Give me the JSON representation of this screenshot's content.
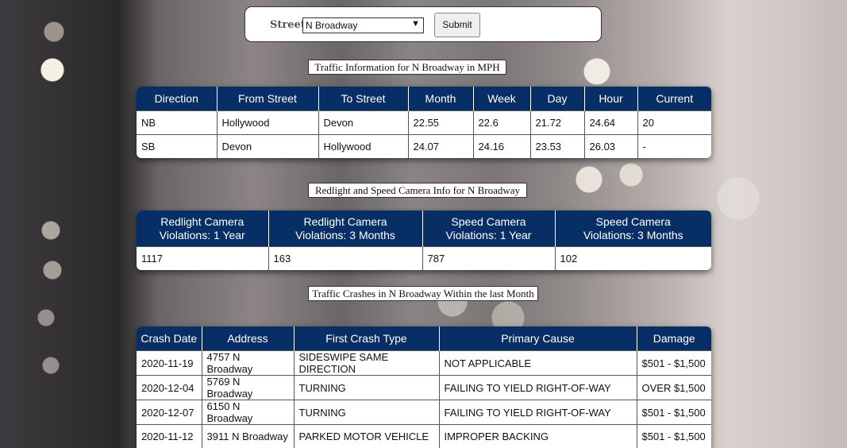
{
  "form": {
    "street_label": "Street:",
    "street_value": "N Broadway",
    "submit_label": "Submit"
  },
  "traffic": {
    "caption": "Traffic Information for N Broadway in MPH",
    "headers": [
      "Direction",
      "From Street",
      "To Street",
      "Month",
      "Week",
      "Day",
      "Hour",
      "Current"
    ],
    "rows": [
      [
        "NB",
        "Hollywood",
        "Devon",
        "22.55",
        "22.6",
        "21.72",
        "24.64",
        "20"
      ],
      [
        "SB",
        "Devon",
        "Hollywood",
        "24.07",
        "24.16",
        "23.53",
        "26.03",
        "-"
      ]
    ]
  },
  "cameras": {
    "caption": "Redlight and Speed Camera Info for N Broadway",
    "headers": [
      [
        "Redlight Camera",
        "Violations: 1 Year"
      ],
      [
        "Redlight Camera",
        "Violations: 3 Months"
      ],
      [
        "Speed Camera",
        "Violations: 1 Year"
      ],
      [
        "Speed Camera",
        "Violations: 3 Months"
      ]
    ],
    "rows": [
      [
        "1117",
        "163",
        "787",
        "102"
      ]
    ]
  },
  "crashes": {
    "caption": "Traffic Crashes in N Broadway Within the last Month",
    "headers": [
      "Crash Date",
      "Address",
      "First Crash Type",
      "Primary Cause",
      "Damage"
    ],
    "rows": [
      [
        "2020-11-19",
        "4757 N Broadway",
        "SIDESWIPE SAME DIRECTION",
        "NOT APPLICABLE",
        "$501 - $1,500"
      ],
      [
        "2020-12-04",
        "5769 N Broadway",
        "TURNING",
        "FAILING TO YIELD RIGHT-OF-WAY",
        "OVER $1,500"
      ],
      [
        "2020-12-07",
        "6150 N Broadway",
        "TURNING",
        "FAILING TO YIELD RIGHT-OF-WAY",
        "$501 - $1,500"
      ],
      [
        "2020-11-12",
        "3911 N Broadway",
        "PARKED MOTOR VEHICLE",
        "IMPROPER BACKING",
        "$501 - $1,500"
      ]
    ]
  }
}
